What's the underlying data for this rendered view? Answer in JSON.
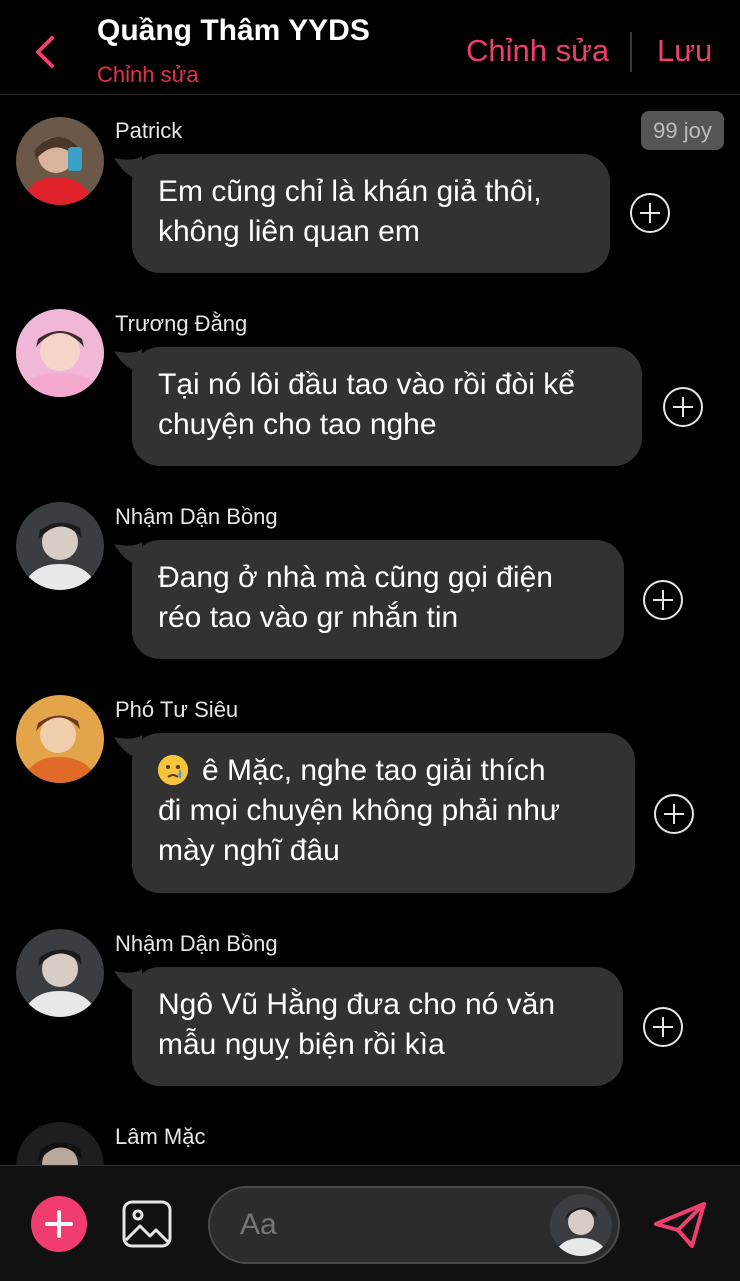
{
  "header": {
    "title": "Quầng Thâm YYDS",
    "subtitle": "Chỉnh sửa",
    "edit_label": "Chỉnh sửa",
    "save_label": "Lưu",
    "accent_color": "#ef3f6e"
  },
  "badge": {
    "label": "99 joy"
  },
  "messages": [
    {
      "sender": "Patrick",
      "lines": [
        "Em cũng chỉ là khán giả thôi,",
        "không liên quan em"
      ]
    },
    {
      "sender": "Trương Đằng",
      "lines": [
        "Tại nó lôi đầu tao vào rồi đòi kể",
        "chuyện cho tao nghe"
      ]
    },
    {
      "sender": "Nhậm Dận Bồng",
      "lines": [
        "Đang ở nhà mà cũng gọi điện",
        "réo tao vào gr nhắn tin"
      ]
    },
    {
      "sender": "Phó Tư Siêu",
      "emoji": "crying-face-emoji",
      "lines": [
        "ê Mặc, nghe tao giải thích",
        "đi mọi chuyện không phải như",
        "mày nghĩ đâu"
      ]
    },
    {
      "sender": "Nhậm Dận Bồng",
      "lines": [
        "Ngô Vũ Hằng đưa cho nó văn",
        "mẫu nguỵ biện rồi kìa"
      ]
    },
    {
      "sender": "Lâm Mặc",
      "lines": []
    }
  ],
  "composer": {
    "placeholder": "Aa",
    "add_icon": "plus-icon",
    "image_icon": "image-icon",
    "send_icon": "send-icon"
  }
}
